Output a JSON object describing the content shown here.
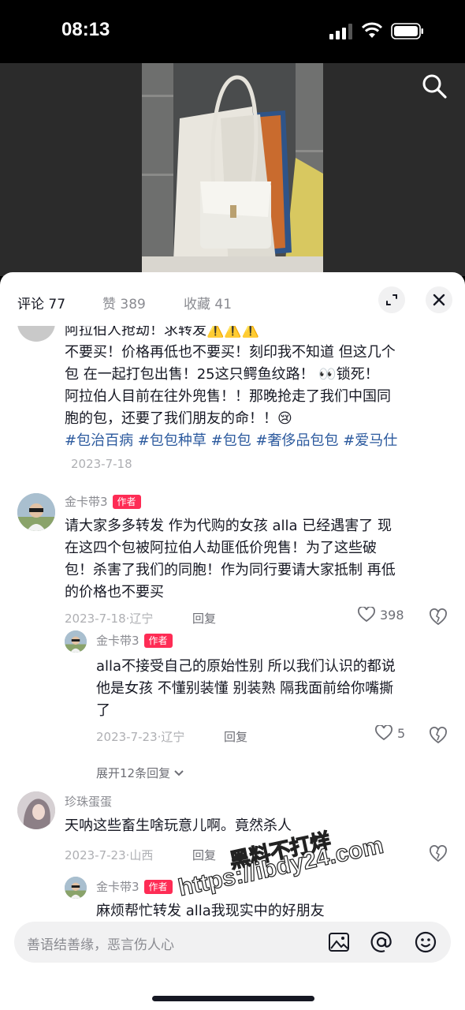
{
  "status_bar": {
    "time": "08:13"
  },
  "tabs": [
    {
      "label": "评论 77",
      "active": true
    },
    {
      "label": "赞 389",
      "active": false
    },
    {
      "label": "收藏 41",
      "active": false
    }
  ],
  "comments": {
    "top": {
      "partial_line": "阿拉伯人抢劫！求转发⚠️⚠️⚠️",
      "lines": [
        "不要买！价格再低也不要买！刻印我不知道 但这几个",
        "包 在一起打包出售！25这只鳄鱼纹路！ 👀锁死！",
        "阿拉伯人目前在往外兜售！！那晚抢走了我们中国同",
        "胞的包，还要了我们朋友的命！！😢"
      ],
      "tags": "#包治百病 #包包种草 #包包 #奢侈品包包 #爱马仕",
      "date": "2023-7-18"
    },
    "c1": {
      "author": "金卡带3",
      "badge": "作者",
      "lines": [
        "请大家多多转发 作为代购的女孩 alla 已经遇害了 现",
        "在这四个包被阿拉伯人劫匪低价兜售！为了这些破",
        "包！杀害了我们的同胞！作为同行要请大家抵制 再低",
        "的价格也不要买"
      ],
      "date": "2023-7-18·辽宁",
      "reply": "回复",
      "likes": "398"
    },
    "r1": {
      "author": "金卡带3",
      "badge": "作者",
      "lines": [
        "alla不接受自己的原始性别 所以我们认识的都说",
        "他是女孩 不懂别装懂 别装熟 隔我面前给你嘴撕",
        "了"
      ],
      "date": "2023-7-23·辽宁",
      "reply": "回复",
      "likes": "5",
      "expand": "展开12条回复"
    },
    "c2": {
      "author": "珍珠蛋蛋",
      "text": "天呐这些畜生啥玩意儿啊。竟然杀人",
      "date": "2023-7-23·山西",
      "reply": "回复"
    },
    "r2": {
      "author": "金卡带3",
      "badge": "作者",
      "text": "麻烦帮忙转发 alla我现实中的好朋友"
    }
  },
  "input": {
    "placeholder": "善语结善缘，恶言伤人心"
  },
  "watermark": {
    "line1": "黑料不打烊",
    "line2": "https://ibdy24.com"
  },
  "colors": {
    "accent": "#fe2c55",
    "hashtag": "#2c5a9e"
  },
  "icons": [
    "signal-icon",
    "wifi-icon",
    "battery-icon",
    "search-icon",
    "expand-icon",
    "close-icon",
    "heart-icon",
    "dislike-icon",
    "chevron-down-icon",
    "image-icon",
    "at-icon",
    "emoji-icon"
  ]
}
